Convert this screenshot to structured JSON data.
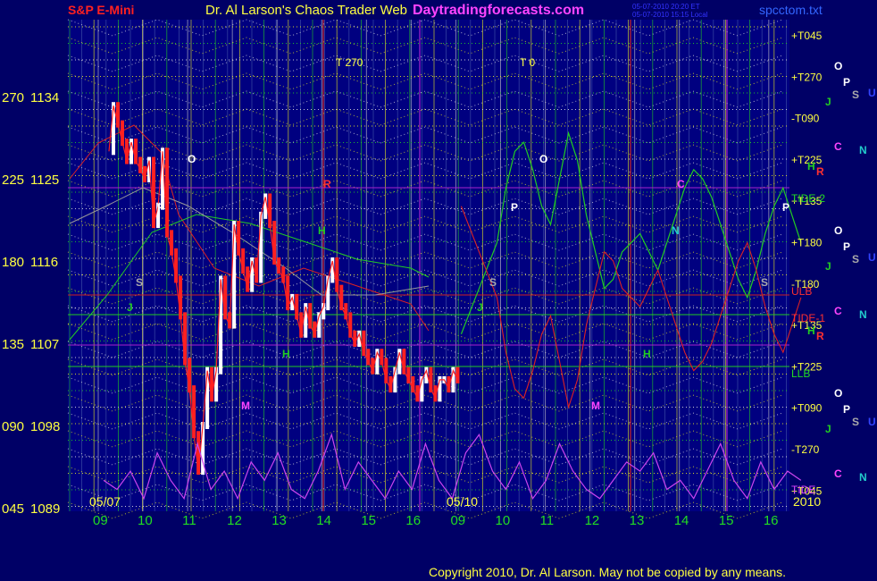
{
  "header": {
    "instrument": "S&P E-Mini",
    "title": "Dr. Al Larson's Chaos Trader Web",
    "site": "Daytradingforecasts.com",
    "stamp_1": "05-07-2010 20:20 ET",
    "stamp_2": "05-07-2010 15:15 Local",
    "file": "spcctom.txt"
  },
  "footer": {
    "copyright": "Copyright 2010, Dr. Al Larson. May not be copied by any means."
  },
  "colors": {
    "background": "#000066",
    "plot_bg": "#000080",
    "price_up": "#ffffff",
    "price_down": "#ff2020",
    "grid_green": "#22cc22",
    "grid_yellow": "#e8e820",
    "grid_red": "#cc2222",
    "grid_purple": "#aa22cc",
    "tide_purple": "#cc44ee",
    "ma_green": "#22cc22",
    "ma_red": "#dd2222"
  },
  "chart_data": {
    "type": "line",
    "title": "S&P E-Mini",
    "y_left_angles": [
      "270",
      "225",
      "180",
      "135",
      "090",
      "045"
    ],
    "y_left_prices": [
      "1134",
      "1125",
      "1116",
      "1107",
      "1098",
      "1089"
    ],
    "ylim": [
      1089,
      1134
    ],
    "x_ticks": [
      "09",
      "10",
      "11",
      "12",
      "13",
      "14",
      "15",
      "16",
      "09",
      "10",
      "11",
      "12",
      "13",
      "14",
      "15",
      "16"
    ],
    "date_labels": [
      "05/07",
      "05/10",
      "2010"
    ],
    "top_markers": [
      "T  270",
      "T  0"
    ],
    "right_labels": [
      "+T045",
      "+T270",
      "-T090",
      "+T225",
      "+T135",
      "+T180",
      "-T180",
      "+T135",
      "+T225",
      "+T090",
      "-T270",
      "+T045"
    ],
    "right_flux": [
      "TIDE-2",
      "ULB",
      "TIDE-1",
      "LLB",
      "TIDE"
    ],
    "planet_glyphs": [
      "O",
      "P",
      "S",
      "U",
      "J",
      "C",
      "N",
      "H",
      "R",
      "M"
    ],
    "series": [
      {
        "name": "price",
        "x": [
          0.0,
          0.1,
          0.2,
          0.3,
          0.4,
          0.5,
          0.6,
          0.7,
          0.8,
          0.9,
          1.0,
          1.1,
          1.2,
          1.3,
          1.4,
          1.5,
          1.6,
          1.7,
          1.8,
          1.9,
          2.0,
          2.1,
          2.2,
          2.3,
          2.4,
          2.5,
          2.6,
          2.7,
          2.8,
          2.9,
          3.0,
          3.1,
          3.2,
          3.3,
          3.4,
          3.5,
          3.6,
          3.7,
          3.8,
          3.9,
          4.0,
          4.1,
          4.2,
          4.3,
          4.4,
          4.5,
          4.6,
          4.7,
          4.8,
          4.9,
          5.0,
          5.1,
          5.2,
          5.3,
          5.4,
          5.5,
          5.6,
          5.7,
          5.8,
          5.9,
          6.0,
          6.1,
          6.2,
          6.3,
          6.4,
          6.5,
          6.6,
          6.7,
          6.8,
          6.9,
          7.0,
          7.1,
          7.2,
          7.3,
          7.4,
          7.5,
          7.6,
          7.7,
          7.8
        ],
        "values": [
          1128,
          1133,
          1131,
          1129,
          1127,
          1129,
          1127,
          1126,
          1125,
          1127,
          1120,
          1122,
          1128,
          1119,
          1117,
          1114,
          1110,
          1105,
          1102,
          1097,
          1093,
          1098,
          1104,
          1101,
          1104,
          1114,
          1110,
          1109,
          1120,
          1117,
          1115,
          1113,
          1116,
          1114,
          1121,
          1123,
          1120,
          1116,
          1115,
          1114,
          1111,
          1112,
          1110,
          1108,
          1111,
          1109,
          1108,
          1110,
          1111,
          1114,
          1116,
          1113,
          1111,
          1110,
          1108,
          1107,
          1108,
          1106,
          1105,
          1104,
          1106,
          1105,
          1103,
          1102,
          1104,
          1106,
          1104,
          1103,
          1102,
          1101,
          1103,
          1104,
          1102,
          1101,
          1103,
          1103,
          1102,
          1104,
          1103
        ]
      },
      {
        "name": "forecast",
        "x": [
          8.0,
          8.4,
          8.8,
          9.0,
          9.2,
          9.4,
          9.6,
          9.8,
          10.0,
          10.2,
          10.4,
          10.6,
          10.8,
          11.0,
          11.2,
          11.4,
          11.6,
          11.8,
          12.0,
          12.2,
          12.4,
          12.6,
          12.8,
          13.0,
          13.2,
          13.4,
          13.6,
          13.8,
          14.0,
          14.2,
          14.4,
          14.6,
          14.8,
          15.0,
          15.2,
          15.4,
          15.6
        ],
        "values": [
          1108,
          1113,
          1118,
          1124,
          1128,
          1129,
          1126,
          1122,
          1120,
          1125,
          1130,
          1127,
          1121,
          1117,
          1113,
          1114,
          1117,
          1118,
          1119,
          1117,
          1115,
          1118,
          1121,
          1124,
          1126,
          1125,
          1123,
          1120,
          1117,
          1114,
          1112,
          1115,
          1119,
          1122,
          1124,
          1121,
          1118
        ]
      },
      {
        "name": "tide",
        "x": [
          0.0,
          0.3,
          0.6,
          0.9,
          1.2,
          1.5,
          1.8,
          2.1,
          2.4,
          2.7,
          3.0,
          3.3,
          3.6,
          3.9,
          4.2,
          4.5,
          4.8,
          5.1,
          5.4,
          5.7,
          6.0,
          6.3,
          6.6,
          6.9,
          7.2,
          7.5,
          7.8,
          8.1,
          8.4,
          8.7,
          9.0,
          9.3,
          9.6,
          9.9,
          10.2,
          10.5,
          10.8,
          11.1,
          11.4,
          11.7,
          12.0,
          12.3,
          12.6,
          12.9,
          13.2,
          13.5,
          13.8,
          14.1,
          14.4,
          14.7,
          15.0,
          15.3,
          15.6
        ],
        "values": [
          1092,
          1091,
          1093,
          1090,
          1095,
          1092,
          1090,
          1096,
          1091,
          1093,
          1090,
          1094,
          1092,
          1095,
          1091,
          1090,
          1093,
          1097,
          1091,
          1094,
          1092,
          1090,
          1093,
          1091,
          1096,
          1092,
          1090,
          1095,
          1097,
          1093,
          1091,
          1094,
          1090,
          1092,
          1096,
          1093,
          1091,
          1090,
          1092,
          1094,
          1093,
          1095,
          1091,
          1092,
          1090,
          1093,
          1096,
          1092,
          1090,
          1094,
          1091,
          1093,
          1092
        ]
      }
    ]
  }
}
